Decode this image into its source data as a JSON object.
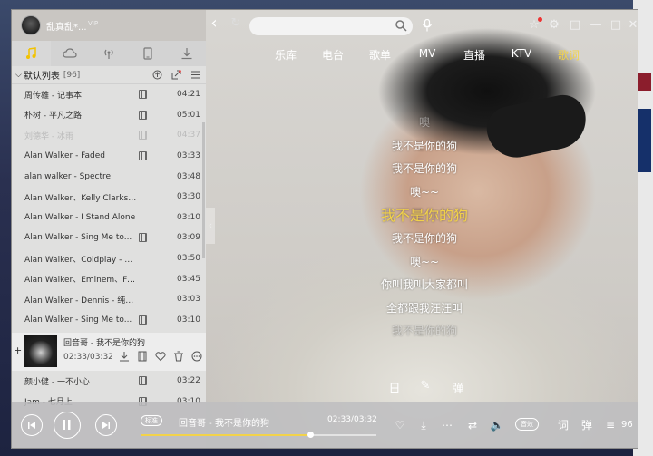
{
  "header": {
    "username": "乱真乱*...",
    "vip_label": "VIP"
  },
  "tabs": [
    {
      "label": "乐库",
      "active": false
    },
    {
      "label": "电台",
      "active": false
    },
    {
      "label": "歌单",
      "active": false
    },
    {
      "label": "MV",
      "active": false
    },
    {
      "label": "直播",
      "active": false
    },
    {
      "label": "KTV",
      "active": false
    },
    {
      "label": "歌词",
      "active": true
    }
  ],
  "playlist": {
    "title": "默认列表",
    "count": "[96]",
    "songs": [
      {
        "name": "周传雄 - 记事本",
        "time": "04:21",
        "mv": true,
        "dim": false
      },
      {
        "name": "朴树 - 平凡之路",
        "time": "05:01",
        "mv": true,
        "dim": false
      },
      {
        "name": "刘德华 - 冰雨",
        "time": "04:37",
        "mv": true,
        "dim": true
      },
      {
        "name": "Alan Walker - Faded",
        "time": "03:33",
        "mv": true,
        "dim": false
      },
      {
        "name": "alan walker - Spectre",
        "time": "03:48",
        "mv": false,
        "dim": false
      },
      {
        "name": "Alan Walker、Kelly Clarkson ...",
        "time": "03:30",
        "mv": false,
        "dim": false
      },
      {
        "name": "Alan Walker - I Stand Alone",
        "time": "03:10",
        "mv": false,
        "dim": false
      },
      {
        "name": "Alan Walker - Sing Me to...",
        "time": "03:09",
        "mv": true,
        "dim": false
      },
      {
        "name": "Alan Walker、Coldplay - Hy...",
        "time": "03:50",
        "mv": false,
        "dim": false
      },
      {
        "name": "Alan Walker、Eminem、Fort ...",
        "time": "03:45",
        "mv": false,
        "dim": false
      },
      {
        "name": "Alan Walker - Dennis - 纯音...",
        "time": "03:03",
        "mv": false,
        "dim": false
      },
      {
        "name": "Alan Walker - Sing Me to...",
        "time": "03:10",
        "mv": true,
        "dim": false
      }
    ],
    "songs_after": [
      {
        "name": "颜小健 - 一不小心",
        "time": "03:22",
        "mv": true,
        "dim": false
      },
      {
        "name": "Jam - 七月上",
        "time": "03:10",
        "mv": true,
        "dim": false
      }
    ]
  },
  "now_playing": {
    "title": "回音哥 - 我不是你的狗",
    "time": "02:33/03:32"
  },
  "lyrics": [
    {
      "text": "噢",
      "state": "faded"
    },
    {
      "text": "我不是你的狗",
      "state": "normal"
    },
    {
      "text": "我不是你的狗",
      "state": "normal"
    },
    {
      "text": "噢~~",
      "state": "normal"
    },
    {
      "text": "我不是你的狗",
      "state": "active"
    },
    {
      "text": "我不是你的狗",
      "state": "normal"
    },
    {
      "text": "噢~~",
      "state": "normal"
    },
    {
      "text": "你叫我叫大家都叫",
      "state": "normal"
    },
    {
      "text": "全都跟我汪汪叫",
      "state": "normal"
    },
    {
      "text": "我不是你的狗",
      "state": "faded"
    }
  ],
  "player": {
    "tag": "标准",
    "title": "回音哥 - 我不是你的狗",
    "time": "02:33/03:32",
    "progress": 0.72,
    "quality": "音效",
    "list_count": "96"
  },
  "colors": {
    "accent": "#f2d24a",
    "text_light": "#ffffff"
  }
}
